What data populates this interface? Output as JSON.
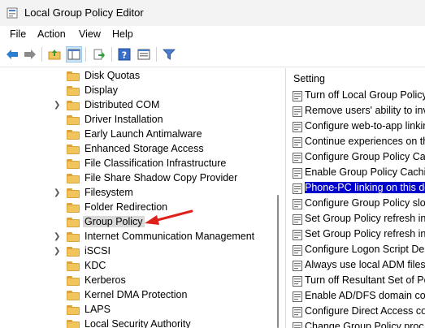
{
  "window": {
    "title": "Local Group Policy Editor"
  },
  "menu": [
    "File",
    "Action",
    "View",
    "Help"
  ],
  "toolbar": {
    "buttons": [
      "back-icon",
      "forward-icon",
      "up-folder-icon",
      "show-hide-console-tree-icon",
      "export-list-icon",
      "help-icon",
      "properties-icon",
      "filter-icon"
    ]
  },
  "tree": {
    "items": [
      {
        "label": "Disk Quotas",
        "expandable": false
      },
      {
        "label": "Display",
        "expandable": false
      },
      {
        "label": "Distributed COM",
        "expandable": true
      },
      {
        "label": "Driver Installation",
        "expandable": false
      },
      {
        "label": "Early Launch Antimalware",
        "expandable": false
      },
      {
        "label": "Enhanced Storage Access",
        "expandable": false
      },
      {
        "label": "File Classification Infrastructure",
        "expandable": false
      },
      {
        "label": "File Share Shadow Copy Provider",
        "expandable": false
      },
      {
        "label": "Filesystem",
        "expandable": true
      },
      {
        "label": "Folder Redirection",
        "expandable": false
      },
      {
        "label": "Group Policy",
        "expandable": true,
        "selected": true
      },
      {
        "label": "Internet Communication Management",
        "expandable": true
      },
      {
        "label": "iSCSI",
        "expandable": true
      },
      {
        "label": "KDC",
        "expandable": false
      },
      {
        "label": "Kerberos",
        "expandable": false
      },
      {
        "label": "Kernel DMA Protection",
        "expandable": false
      },
      {
        "label": "LAPS",
        "expandable": false
      },
      {
        "label": "Local Security Authority",
        "expandable": false
      }
    ]
  },
  "settings": {
    "header": "Setting",
    "items": [
      "Turn off Local Group Policy",
      "Remove users' ability to inv",
      "Configure web-to-app linkin",
      "Continue experiences on thi",
      "Configure Group Policy Cac",
      "Enable Group Policy Cachin",
      "Phone-PC linking on this de",
      "Configure Group Policy slov",
      "Set Group Policy refresh inte",
      "Set Group Policy refresh inte",
      "Configure Logon Script Dela",
      "Always use local ADM files f",
      "Turn off Resultant Set of Po",
      "Enable AD/DFS domain con",
      "Configure Direct Access cor",
      "Change Group Policy proc"
    ],
    "highlighted_index": 6
  },
  "colors": {
    "highlight": "#0000cc",
    "arrow": "#e0201b",
    "folder": "#f2c55c"
  }
}
